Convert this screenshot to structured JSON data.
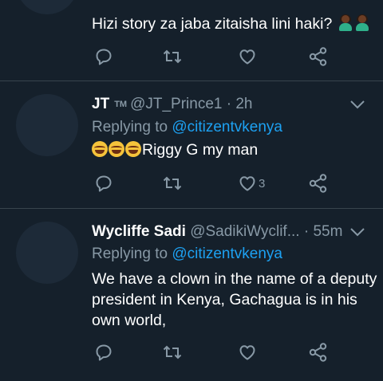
{
  "tweets": [
    {
      "text": "Hizi story za jaba zitaisha lini haki?",
      "emoji": [
        "woman-facepalming-icon",
        "woman-facepalming-icon"
      ],
      "likes": ""
    },
    {
      "name": "JT",
      "badge": "TM",
      "handle": "@JT_Prince1",
      "time": "· 2h",
      "replying_to": "Replying to",
      "replying_handle": "@citizentvkenya",
      "text": "Riggy G my man",
      "emoji": [
        "joy-icon",
        "joy-icon",
        "joy-icon"
      ],
      "likes": "3"
    },
    {
      "name": "Wycliffe Sadi",
      "handle": "@SadikiWyclif...",
      "time": "· 55m",
      "replying_to": "Replying to",
      "replying_handle": "@citizentvkenya",
      "text_lines": [
        "We have a clown in the name of a deputy",
        "president in Kenya, Gachagua is in his",
        "own world,"
      ],
      "likes": ""
    }
  ],
  "colors": {
    "background": "#15202b",
    "divider": "#38444d",
    "muted": "#8899a6",
    "link": "#1da1f2",
    "text": "#ffffff"
  }
}
